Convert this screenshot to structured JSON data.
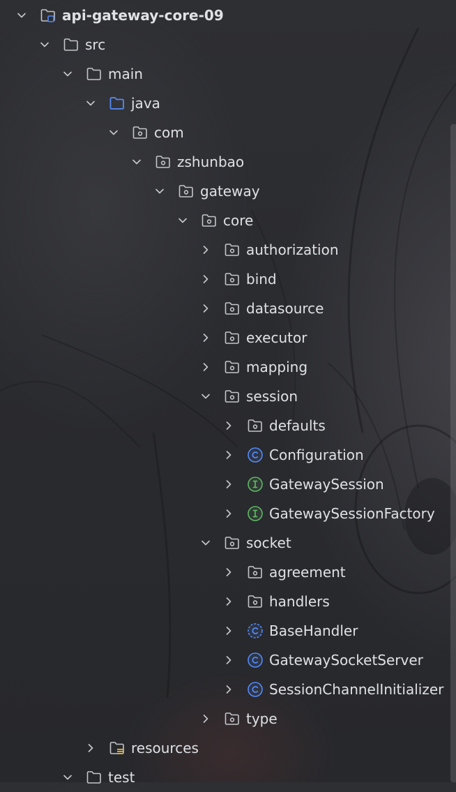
{
  "project_tree": {
    "items": [
      {
        "label": "api-gateway-core-09",
        "icon": "project-module-icon",
        "expanded": true
      },
      {
        "label": "src",
        "icon": "folder-icon",
        "expanded": true
      },
      {
        "label": "main",
        "icon": "folder-icon",
        "expanded": true
      },
      {
        "label": "java",
        "icon": "source-root-folder-icon",
        "expanded": true
      },
      {
        "label": "com",
        "icon": "package-icon",
        "expanded": true
      },
      {
        "label": "zshunbao",
        "icon": "package-icon",
        "expanded": true
      },
      {
        "label": "gateway",
        "icon": "package-icon",
        "expanded": true
      },
      {
        "label": "core",
        "icon": "package-icon",
        "expanded": true
      },
      {
        "label": "authorization",
        "icon": "package-icon",
        "expanded": false
      },
      {
        "label": "bind",
        "icon": "package-icon",
        "expanded": false
      },
      {
        "label": "datasource",
        "icon": "package-icon",
        "expanded": false
      },
      {
        "label": "executor",
        "icon": "package-icon",
        "expanded": false
      },
      {
        "label": "mapping",
        "icon": "package-icon",
        "expanded": false
      },
      {
        "label": "session",
        "icon": "package-icon",
        "expanded": true
      },
      {
        "label": "defaults",
        "icon": "package-icon",
        "expanded": false
      },
      {
        "label": "Configuration",
        "icon": "class-icon",
        "expanded": false
      },
      {
        "label": "GatewaySession",
        "icon": "interface-icon",
        "expanded": false
      },
      {
        "label": "GatewaySessionFactory",
        "icon": "interface-icon",
        "expanded": false
      },
      {
        "label": "socket",
        "icon": "package-icon",
        "expanded": true
      },
      {
        "label": "agreement",
        "icon": "package-icon",
        "expanded": false
      },
      {
        "label": "handlers",
        "icon": "package-icon",
        "expanded": false
      },
      {
        "label": "BaseHandler",
        "icon": "abstract-class-icon",
        "expanded": false
      },
      {
        "label": "GatewaySocketServer",
        "icon": "class-icon",
        "expanded": false
      },
      {
        "label": "SessionChannelInitializer",
        "icon": "class-icon",
        "expanded": false
      },
      {
        "label": "type",
        "icon": "package-icon",
        "expanded": false
      },
      {
        "label": "resources",
        "icon": "resources-folder-icon",
        "expanded": false
      },
      {
        "label": "test",
        "icon": "folder-icon",
        "expanded": true
      }
    ]
  },
  "colors": {
    "text": "#dfe1e5",
    "icon_gray": "#c4c6ca",
    "source_root_blue": "#548af7",
    "class_blue": "#548af7",
    "interface_green": "#5fb865",
    "resources_yellow": "#e0b040"
  }
}
